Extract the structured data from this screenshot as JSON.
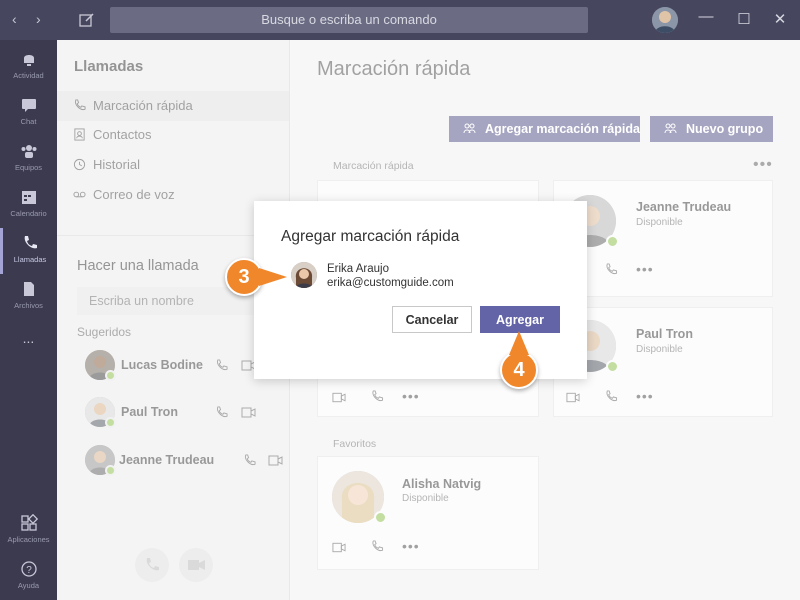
{
  "topbar": {
    "search_placeholder": "Busque o escriba un comando",
    "back_icon": "chevron-left-icon",
    "forward_icon": "chevron-right-icon",
    "compose_icon": "compose-icon",
    "window_controls": [
      "minimize",
      "maximize",
      "close"
    ]
  },
  "rail": {
    "items": [
      {
        "label": "Actividad",
        "icon": "bell-icon"
      },
      {
        "label": "Chat",
        "icon": "chat-icon"
      },
      {
        "label": "Equipos",
        "icon": "teams-icon"
      },
      {
        "label": "Calendario",
        "icon": "calendar-icon"
      },
      {
        "label": "Llamadas",
        "icon": "phone-icon",
        "active": true
      },
      {
        "label": "Archivos",
        "icon": "file-icon"
      },
      {
        "label": "...",
        "icon": "more-icon"
      }
    ],
    "bottom": [
      {
        "label": "Aplicaciones",
        "icon": "apps-icon"
      },
      {
        "label": "Ayuda",
        "icon": "help-icon"
      }
    ]
  },
  "calls": {
    "title": "Llamadas",
    "nav": [
      {
        "label": "Marcación rápida",
        "icon": "phone-icon",
        "active": true
      },
      {
        "label": "Contactos",
        "icon": "contacts-icon"
      },
      {
        "label": "Historial",
        "icon": "history-icon"
      },
      {
        "label": "Correo de voz",
        "icon": "voicemail-icon"
      }
    ],
    "make_call_title": "Hacer una llamada",
    "name_placeholder": "Escriba un nombre",
    "suggested_label": "Sugeridos",
    "suggested": [
      {
        "name": "Lucas Bodine"
      },
      {
        "name": "Paul Tron"
      },
      {
        "name": "Jeanne Trudeau"
      }
    ]
  },
  "main": {
    "title": "Marcación rápida",
    "add_speed_dial_label": "Agregar marcación rápida",
    "new_group_label": "Nuevo grupo",
    "speed_dial_section": "Marcación rápida",
    "favorites_section": "Favoritos",
    "more": "•••",
    "cards": [
      {
        "name": "Jeanne Trudeau",
        "status": "Disponible"
      },
      {
        "name": "Paul Tron",
        "status": "Disponible"
      }
    ],
    "favorites": [
      {
        "name": "Alisha Natvig",
        "status": "Disponible"
      }
    ]
  },
  "dialog": {
    "title": "Agregar marcación rápida",
    "person_name": "Erika Araujo",
    "person_email": "erika@customguide.com",
    "cancel_label": "Cancelar",
    "add_label": "Agregar"
  },
  "callouts": {
    "step3": "3",
    "step4": "4"
  },
  "colors": {
    "accent": "#6264a7",
    "topbar": "#46475f",
    "rail": "#3b3a4f",
    "callout": "#f0872b",
    "status_available": "#92c353"
  }
}
